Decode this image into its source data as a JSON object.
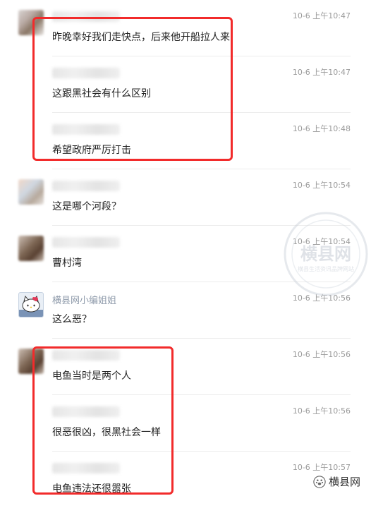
{
  "comments": [
    {
      "avatar": "blurred-avatar",
      "name": "",
      "time": "10-6 上午10:47",
      "text": "昨晚幸好我们走快点，后来他开船拉人来"
    },
    {
      "avatar": "",
      "name": "",
      "time": "10-6 上午10:47",
      "text": "这跟黑社会有什么区别"
    },
    {
      "avatar": "",
      "name": "",
      "time": "10-6 上午10:48",
      "text": "希望政府严厉打击"
    },
    {
      "avatar": "blurred-avatar",
      "name": "",
      "time": "10-6 上午10:54",
      "text": "这是哪个河段？"
    },
    {
      "avatar": "blurred-avatar",
      "name": "",
      "time": "10-6 上午10:54",
      "text": "曹村湾"
    },
    {
      "avatar": "hello-kitty-avatar",
      "name": "横县网小编姐姐",
      "time": "10-6 上午10:56",
      "text": "这么恶？"
    },
    {
      "avatar": "blurred-avatar",
      "name": "",
      "time": "10-6 上午10:56",
      "text": "电鱼当时是两个人"
    },
    {
      "avatar": "",
      "name": "",
      "time": "10-6 上午10:56",
      "text": "很恶很凶，很黑社会一样"
    },
    {
      "avatar": "",
      "name": "",
      "time": "10-6 上午10:57",
      "text": "电鱼违法还很嚣张"
    }
  ],
  "watermark": {
    "text": "横县网",
    "subtext": "横县生活资讯品牌网站"
  },
  "footer": {
    "logo_text": "横县网",
    "icon": "wechat-paw-icon"
  },
  "colors": {
    "highlight_box": "#f22b2b",
    "name": "#8f9bab",
    "time": "#9a9a9a"
  }
}
